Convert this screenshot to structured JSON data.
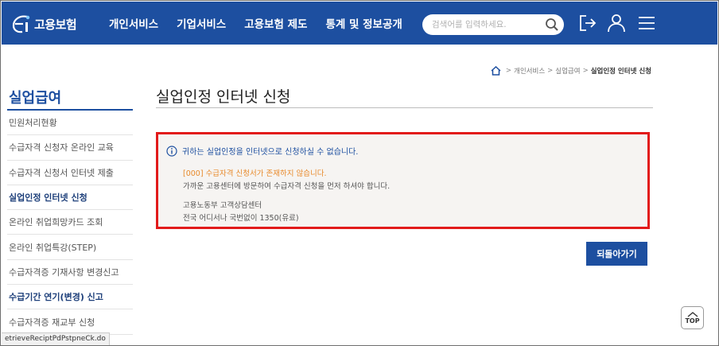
{
  "header": {
    "logo_text": "고용보험",
    "nav": [
      "개인서비스",
      "기업서비스",
      "고용보험 제도",
      "통계 및 정보공개"
    ],
    "search_placeholder": "검색어를 입력하세요.",
    "icons": [
      "logout-icon",
      "user-icon",
      "menu-icon"
    ]
  },
  "breadcrumb": {
    "items": [
      "개인서비스",
      "실업급여"
    ],
    "current": "실업인정 인터넷 신청"
  },
  "sidebar": {
    "title": "실업급여",
    "items": [
      {
        "label": "민원처리현황",
        "active": false
      },
      {
        "label": "수급자격 신청자 온라인 교육",
        "active": false
      },
      {
        "label": "수급자격 신청서 인터넷 제출",
        "active": false
      },
      {
        "label": "실업인정 인터넷 신청",
        "active": true
      },
      {
        "label": "온라인 취업희망카드 조회",
        "active": false
      },
      {
        "label": "온라인 취업특강(STEP)",
        "active": false
      },
      {
        "label": "수급자격증 기재사항 변경신고",
        "active": false
      },
      {
        "label": "수급기간 연기(변경) 신고",
        "active": true
      },
      {
        "label": "수급자격증 재교부 신청",
        "active": false
      }
    ]
  },
  "main": {
    "title": "실업인정 인터넷 신청",
    "notice": {
      "heading": "귀하는 실업인정을 인터넷으로 신청하실 수 없습니다.",
      "error": "[000] 수급자격 신청서가 존재하지 않습니다.",
      "guide": "가까운 고용센터에 방문하여 수급자격 신청을 먼저 하셔야 합니다.",
      "contact_title": "고용노동부 고객상담센터",
      "contact_info": "전국 어디서나 국번없이 1350(유료)"
    },
    "back_button": "되돌아가기"
  },
  "top_button": "TOP",
  "status_url": "etrieveReciptPdPstpneCk.do",
  "colors": {
    "brand": "#1d4fa0",
    "alert_border": "#e21b1b",
    "error_text": "#e8892a"
  }
}
